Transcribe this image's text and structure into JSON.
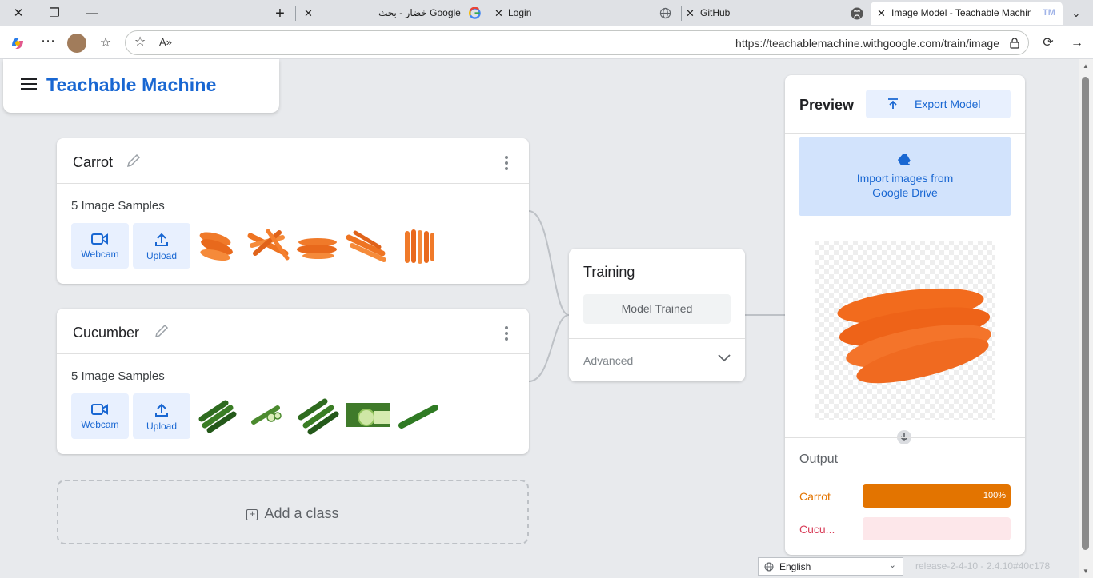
{
  "browser": {
    "tabs": [
      {
        "title": "خضار - بحث Google"
      },
      {
        "title": "Login"
      },
      {
        "title": "GitHub"
      },
      {
        "title": "Image Model - Teachable Machine",
        "tm_badge": "TM"
      }
    ],
    "url": "https://teachablemachine.withgoogle.com/train/image"
  },
  "app": {
    "title": "Teachable Machine"
  },
  "classes": [
    {
      "name": "Carrot",
      "samples_label": "5 Image Samples",
      "webcam_label": "Webcam",
      "upload_label": "Upload"
    },
    {
      "name": "Cucumber",
      "samples_label": "5 Image Samples",
      "webcam_label": "Webcam",
      "upload_label": "Upload"
    }
  ],
  "add_class_label": "Add a class",
  "training": {
    "title": "Training",
    "button_label": "Model Trained",
    "advanced_label": "Advanced"
  },
  "preview": {
    "title": "Preview",
    "export_label": "Export Model",
    "gdrive_line1": "Import images from",
    "gdrive_line2": "Google Drive",
    "output_title": "Output",
    "outputs": [
      {
        "label": "Carrot",
        "percent_label": "100%",
        "fraction": 1.0,
        "color": "#e37400",
        "track": "#fce8d8"
      },
      {
        "label": "Cucu...",
        "percent_label": "",
        "fraction": 0.0,
        "color": "#d93f5a",
        "track": "#fde7ea"
      }
    ]
  },
  "footer": {
    "language": "English",
    "release": "release-2-4-10 - 2.4.10#40c178"
  },
  "colors": {
    "brand": "#1967d2",
    "carrot": "#e37400",
    "cucumber": "#d93f5a"
  }
}
